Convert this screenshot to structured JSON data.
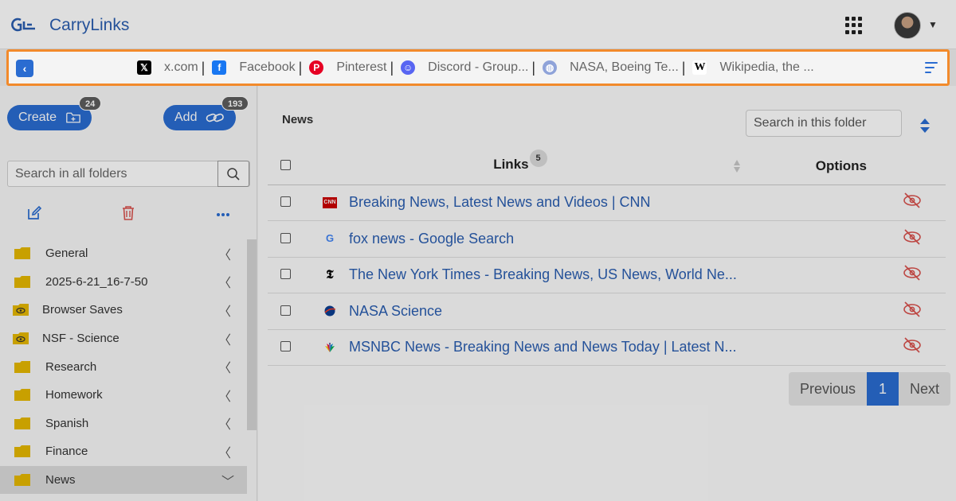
{
  "header": {
    "app_title": "CarryLinks",
    "logo_icon": "carrylinks-logo",
    "apps_icon": "apps-grid-icon",
    "avatar_icon": "user-avatar"
  },
  "bookmarks_bar": {
    "highlight_color": "#f28a2b",
    "items": [
      {
        "label": "x.com",
        "icon": "x-icon"
      },
      {
        "label": "Facebook",
        "icon": "facebook-icon"
      },
      {
        "label": "Pinterest",
        "icon": "pinterest-icon"
      },
      {
        "label": "Discord - Group...",
        "icon": "discord-icon"
      },
      {
        "label": "NASA, Boeing Te...",
        "icon": "globe-icon"
      },
      {
        "label": "Wikipedia, the ...",
        "icon": "wikipedia-icon"
      }
    ],
    "separator": "|"
  },
  "sidebar": {
    "create_label": "Create",
    "create_badge": "24",
    "add_label": "Add",
    "add_badge": "193",
    "search_placeholder": "Search in all folders",
    "folders": [
      {
        "label": "General",
        "type": "folder"
      },
      {
        "label": "2025-6-21_16-7-50",
        "type": "folder"
      },
      {
        "label": "Browser Saves",
        "type": "shared"
      },
      {
        "label": "NSF - Science",
        "type": "shared"
      },
      {
        "label": "Research",
        "type": "folder"
      },
      {
        "label": "Homework",
        "type": "folder"
      },
      {
        "label": "Spanish",
        "type": "folder"
      },
      {
        "label": "Finance",
        "type": "folder"
      },
      {
        "label": "News",
        "type": "folder",
        "active": true
      }
    ]
  },
  "main": {
    "folder_title": "News",
    "search_placeholder": "Search in this folder",
    "table": {
      "col_links": "Links",
      "links_count": "5",
      "col_options": "Options",
      "rows": [
        {
          "title": "Breaking News, Latest News and Videos | CNN",
          "icon": "cnn-icon"
        },
        {
          "title": "fox news - Google Search",
          "icon": "google-icon"
        },
        {
          "title": "The New York Times - Breaking News, US News, World Ne...",
          "icon": "nyt-icon"
        },
        {
          "title": "NASA Science",
          "icon": "nasa-icon"
        },
        {
          "title": "MSNBC News - Breaking News and News Today | Latest N...",
          "icon": "nbc-icon"
        }
      ]
    },
    "pagination": {
      "previous": "Previous",
      "current": "1",
      "next": "Next"
    }
  }
}
